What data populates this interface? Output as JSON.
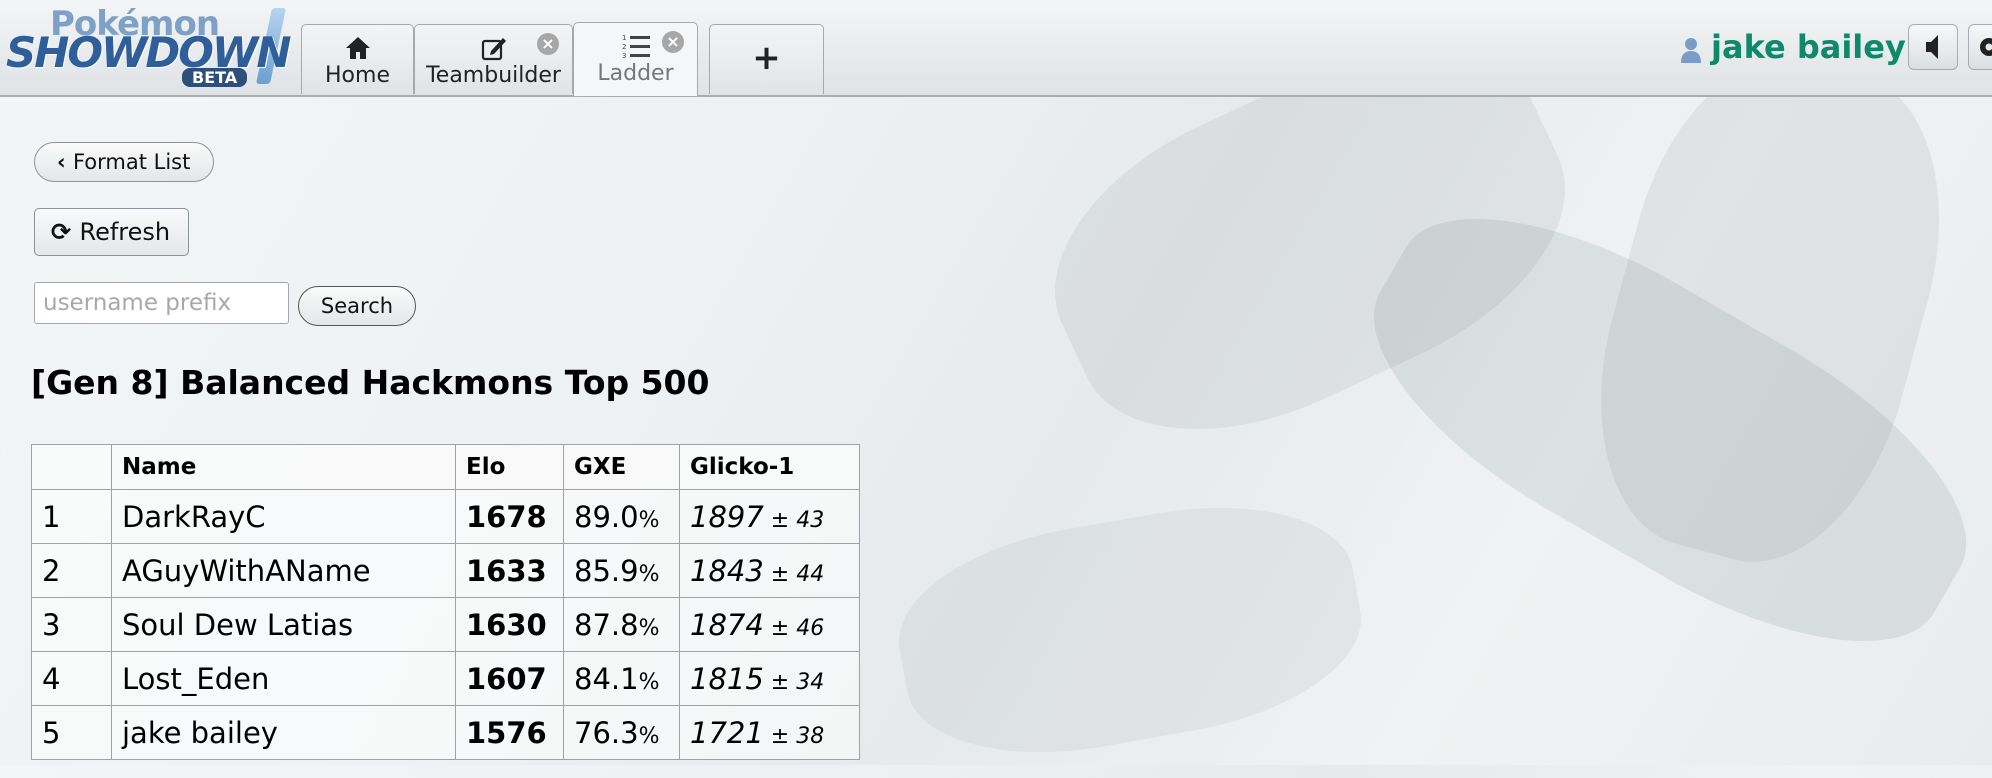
{
  "logo": {
    "top": "Pokémon",
    "main": "SHOWDOWN",
    "badge": "BETA"
  },
  "tabs": [
    {
      "label": "Home",
      "icon": "home-icon"
    },
    {
      "label": "Teambuilder",
      "icon": "edit-icon",
      "closable": true
    },
    {
      "label": "Ladder",
      "icon": "list-ol-icon",
      "closable": true,
      "active": true
    },
    {
      "label": "+",
      "icon": "plus-icon"
    }
  ],
  "user": {
    "name": "jake bailey",
    "color": "#0d8a6a"
  },
  "controls": {
    "format_list": "Format List",
    "refresh": "Refresh",
    "search_placeholder": "username prefix",
    "search_button": "Search"
  },
  "ladder": {
    "title": "[Gen 8] Balanced Hackmons Top 500",
    "columns": [
      "",
      "Name",
      "Elo",
      "GXE",
      "Glicko-1"
    ],
    "rows": [
      {
        "rank": "1",
        "name": "DarkRayC",
        "elo": "1678",
        "gxe": "89.0",
        "glicko": "1897",
        "dev": "43"
      },
      {
        "rank": "2",
        "name": "AGuyWithAName",
        "elo": "1633",
        "gxe": "85.9",
        "glicko": "1843",
        "dev": "44"
      },
      {
        "rank": "3",
        "name": "Soul Dew Latias",
        "elo": "1630",
        "gxe": "87.8",
        "glicko": "1874",
        "dev": "46"
      },
      {
        "rank": "4",
        "name": "Lost_Eden",
        "elo": "1607",
        "gxe": "84.1",
        "glicko": "1815",
        "dev": "34"
      },
      {
        "rank": "5",
        "name": "jake bailey",
        "elo": "1576",
        "gxe": "76.3",
        "glicko": "1721",
        "dev": "38"
      }
    ]
  }
}
